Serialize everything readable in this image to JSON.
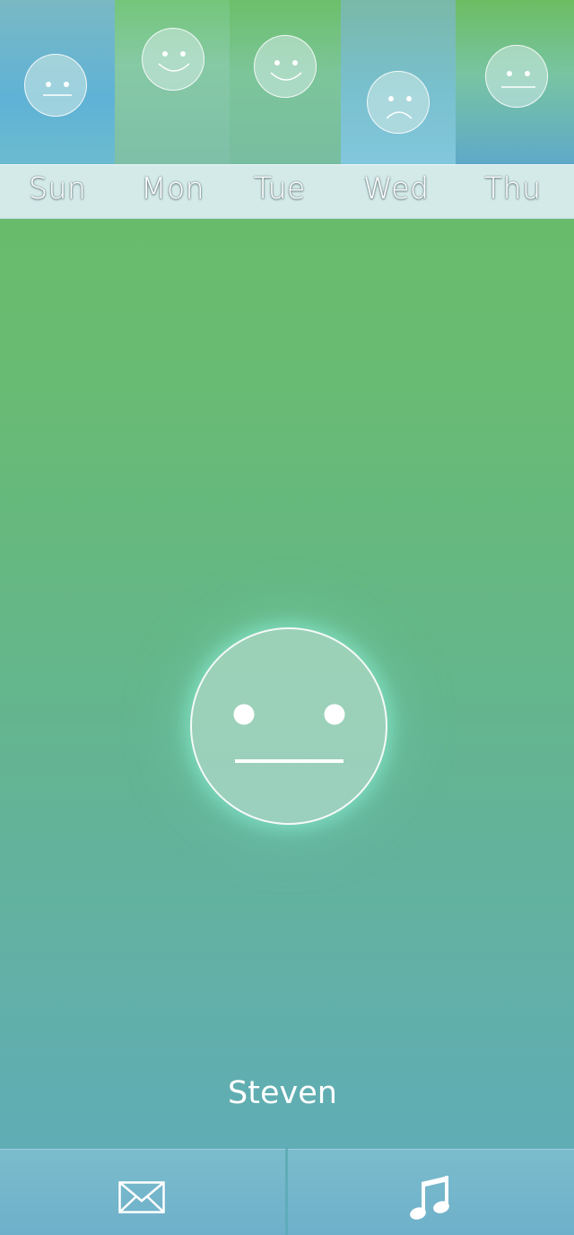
{
  "week": {
    "days": [
      {
        "label": "Sun",
        "mood": "neutral"
      },
      {
        "label": "Mon",
        "mood": "happy"
      },
      {
        "label": "Tue",
        "mood": "happy"
      },
      {
        "label": "Wed",
        "mood": "sad"
      },
      {
        "label": "Thu",
        "mood": "neutral"
      }
    ]
  },
  "current": {
    "mood": "neutral",
    "icon": "neutral-face-icon"
  },
  "user": {
    "name": "Steven"
  },
  "toolbar": {
    "mail_icon": "envelope-icon",
    "music_icon": "music-note-icon"
  },
  "colors": {
    "background_top": "#6bbb63",
    "background_bottom": "#5fabbd",
    "bottom_bar": "#74b5cb",
    "face_glow": "#8cf0d7"
  }
}
